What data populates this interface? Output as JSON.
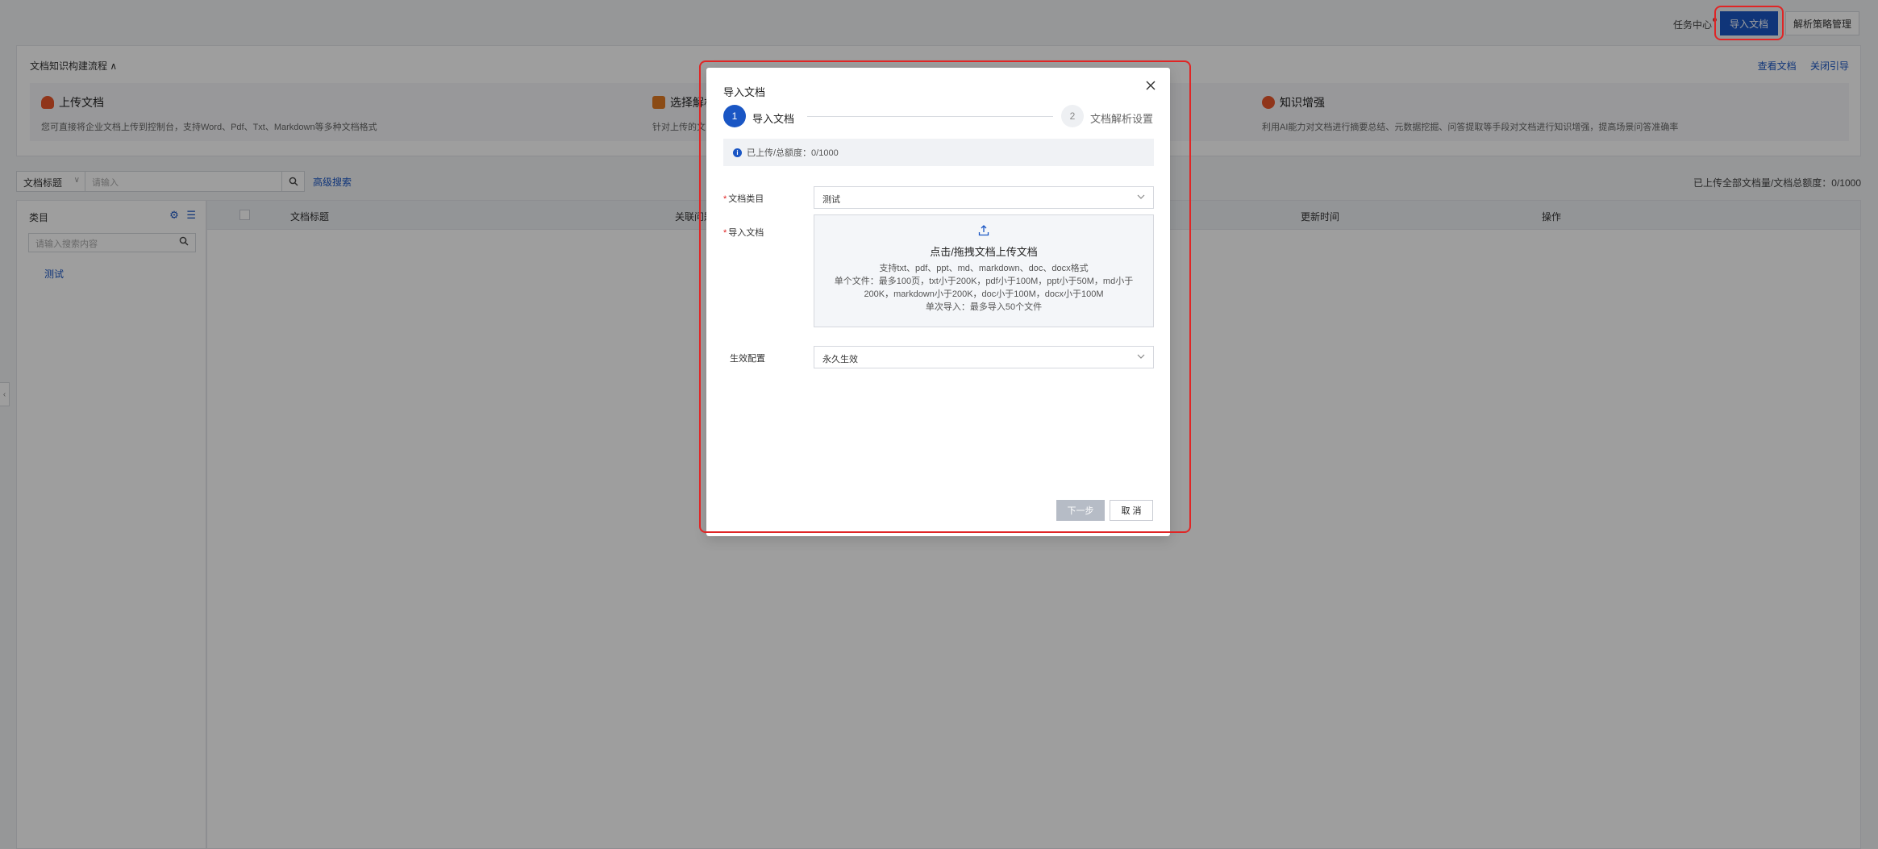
{
  "header": {
    "task_center": "任务中心",
    "import_button": "导入文档",
    "strategy_button": "解析策略管理"
  },
  "flow": {
    "title": "文档知识构建流程",
    "view_docs": "查看文档",
    "close_guide": "关闭引导",
    "steps": [
      {
        "title": "上传文档",
        "desc": "您可直接将企业文档上传到控制台，支持Word、Pdf、Txt、Markdown等多种文档格式"
      },
      {
        "title": "选择解析",
        "desc": "针对上传的文"
      },
      {
        "title": "知识增强",
        "desc": "利用AI能力对文档进行摘要总结、元数据挖掘、问答提取等手段对文档进行知识增强，提高场景问答准确率"
      }
    ]
  },
  "search": {
    "field_label": "文档标题",
    "placeholder": "请输入",
    "advanced": "高级搜索",
    "quota": "已上传全部文档量/文档总额度：0/1000"
  },
  "sidebar": {
    "heading": "类目",
    "search_placeholder": "请输入搜索内容",
    "items": [
      "测试"
    ]
  },
  "table": {
    "columns": [
      "文档标题",
      "关联问题",
      "更新时间",
      "操作"
    ]
  },
  "modal": {
    "title": "导入文档",
    "steps": [
      {
        "num": "1",
        "label": "导入文档"
      },
      {
        "num": "2",
        "label": "文档解析设置"
      }
    ],
    "notice": "已上传/总额度：0/1000",
    "category_label": "文档类目",
    "category_value": "测试",
    "import_label": "导入文档",
    "upload_title": "点击/拖拽文档上传文档",
    "upload_lines": [
      "支持txt、pdf、ppt、md、markdown、doc、docx格式",
      "单个文件：最多100页，txt小于200K，pdf小于100M，ppt小于50M，md小于",
      "200K，markdown小于200K，doc小于100M，docx小于100M",
      "单次导入：最多导入50个文件"
    ],
    "effect_label": "生效配置",
    "effect_value": "永久生效",
    "next_button": "下一步",
    "cancel_button": "取 消"
  },
  "colors": {
    "primary": "#1a56c4",
    "highlight": "#e02525"
  }
}
